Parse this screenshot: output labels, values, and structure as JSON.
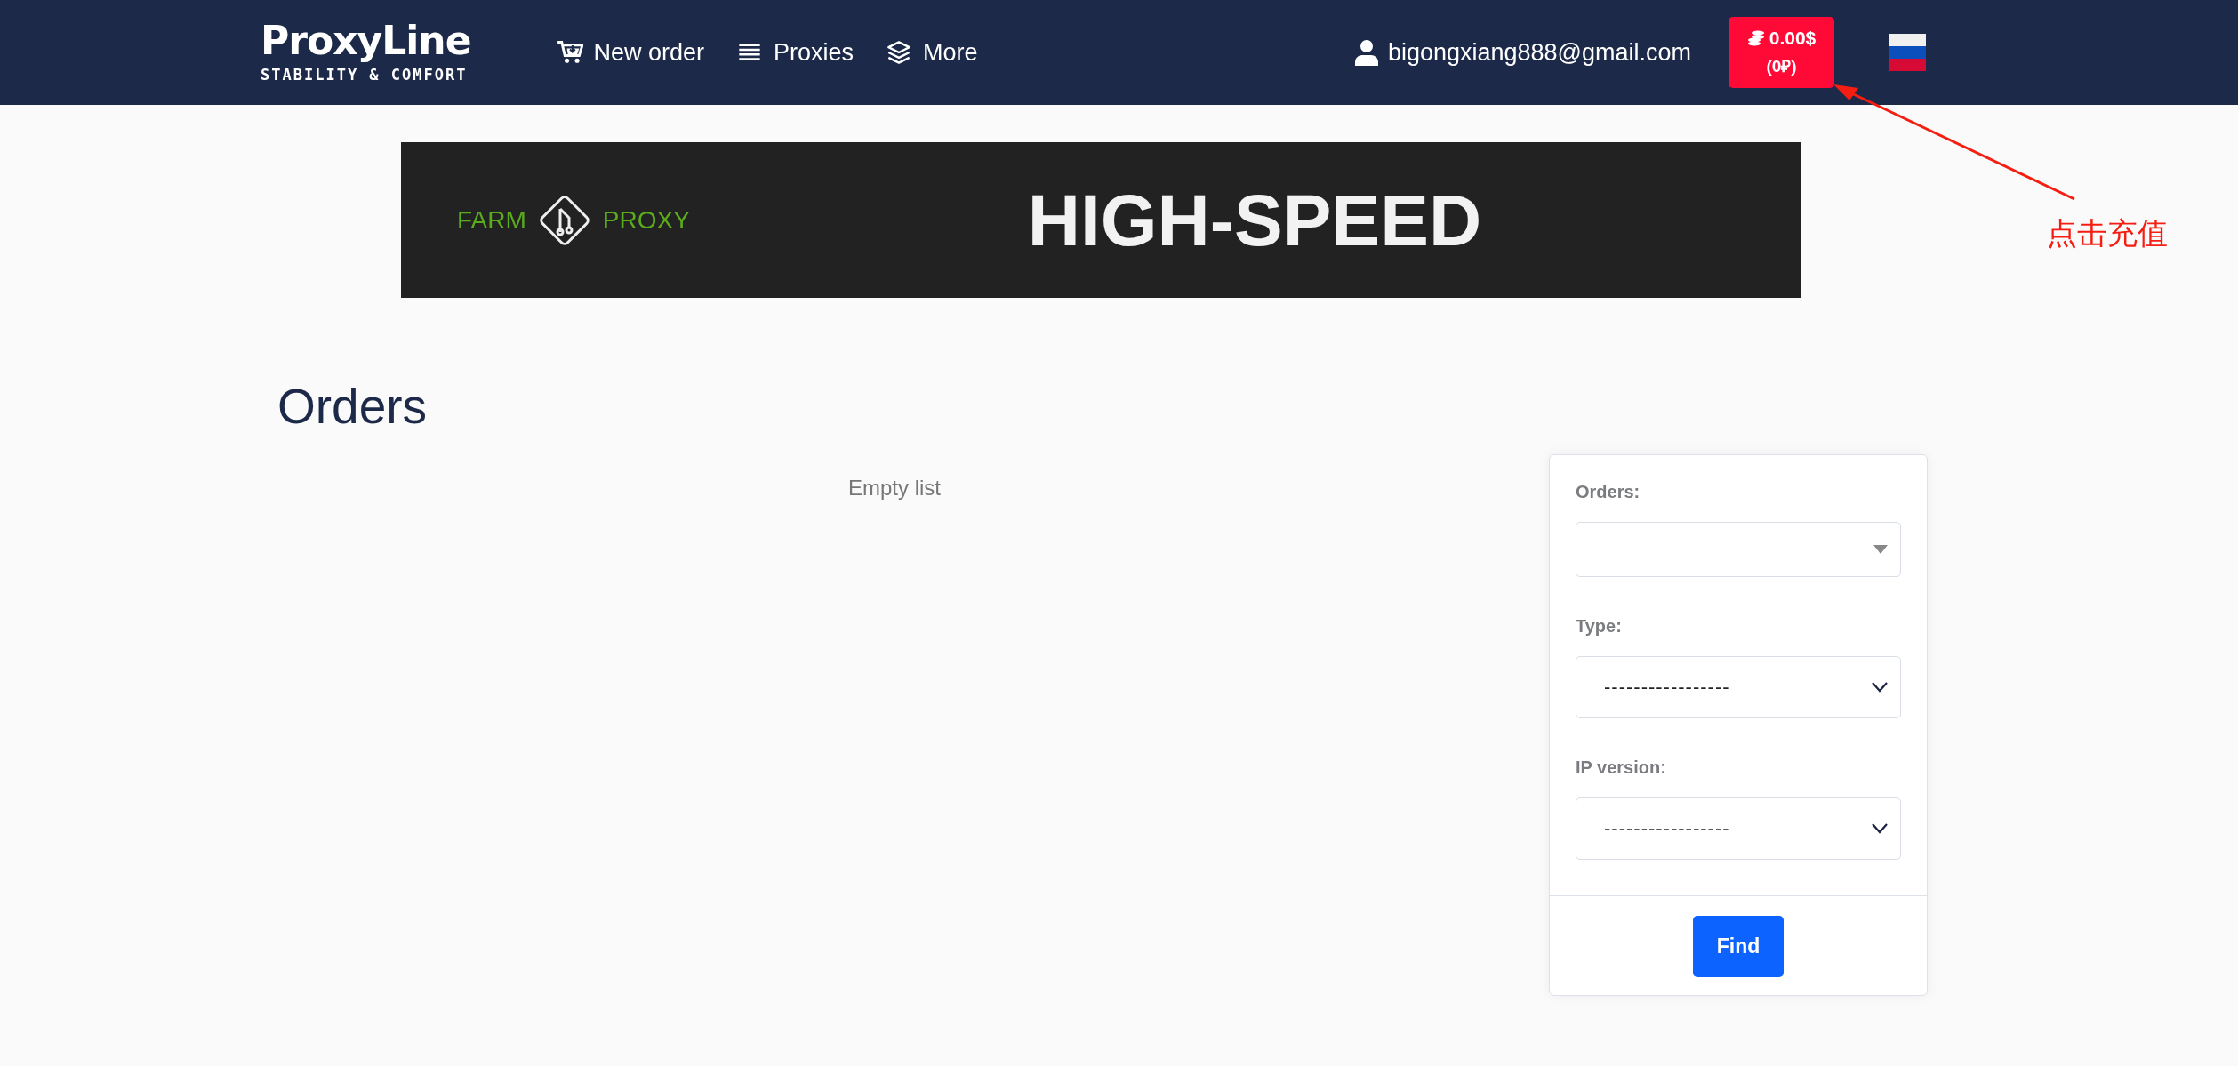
{
  "header": {
    "logo": {
      "name": "ProxyLine",
      "tagline": "STABILITY & COMFORT"
    },
    "nav": [
      {
        "label": "New order"
      },
      {
        "label": "Proxies"
      },
      {
        "label": "More"
      }
    ],
    "user_email": "bigongxiang888@gmail.com",
    "balance": {
      "usd": "0.00$",
      "rub": "(0₽)"
    }
  },
  "banner": {
    "brand_left": "FARM",
    "brand_right": "PROXY",
    "headline": "HIGH-SPEED"
  },
  "page_title": "Orders",
  "empty_message": "Empty list",
  "filters": {
    "fields": [
      {
        "label": "Orders:",
        "kind": "search-select"
      },
      {
        "label": "Type:",
        "kind": "select",
        "value": "-----------------"
      },
      {
        "label": "IP version:",
        "kind": "select",
        "value": "-----------------"
      }
    ],
    "button": "Find"
  },
  "annotation": {
    "text": "点击充值"
  }
}
